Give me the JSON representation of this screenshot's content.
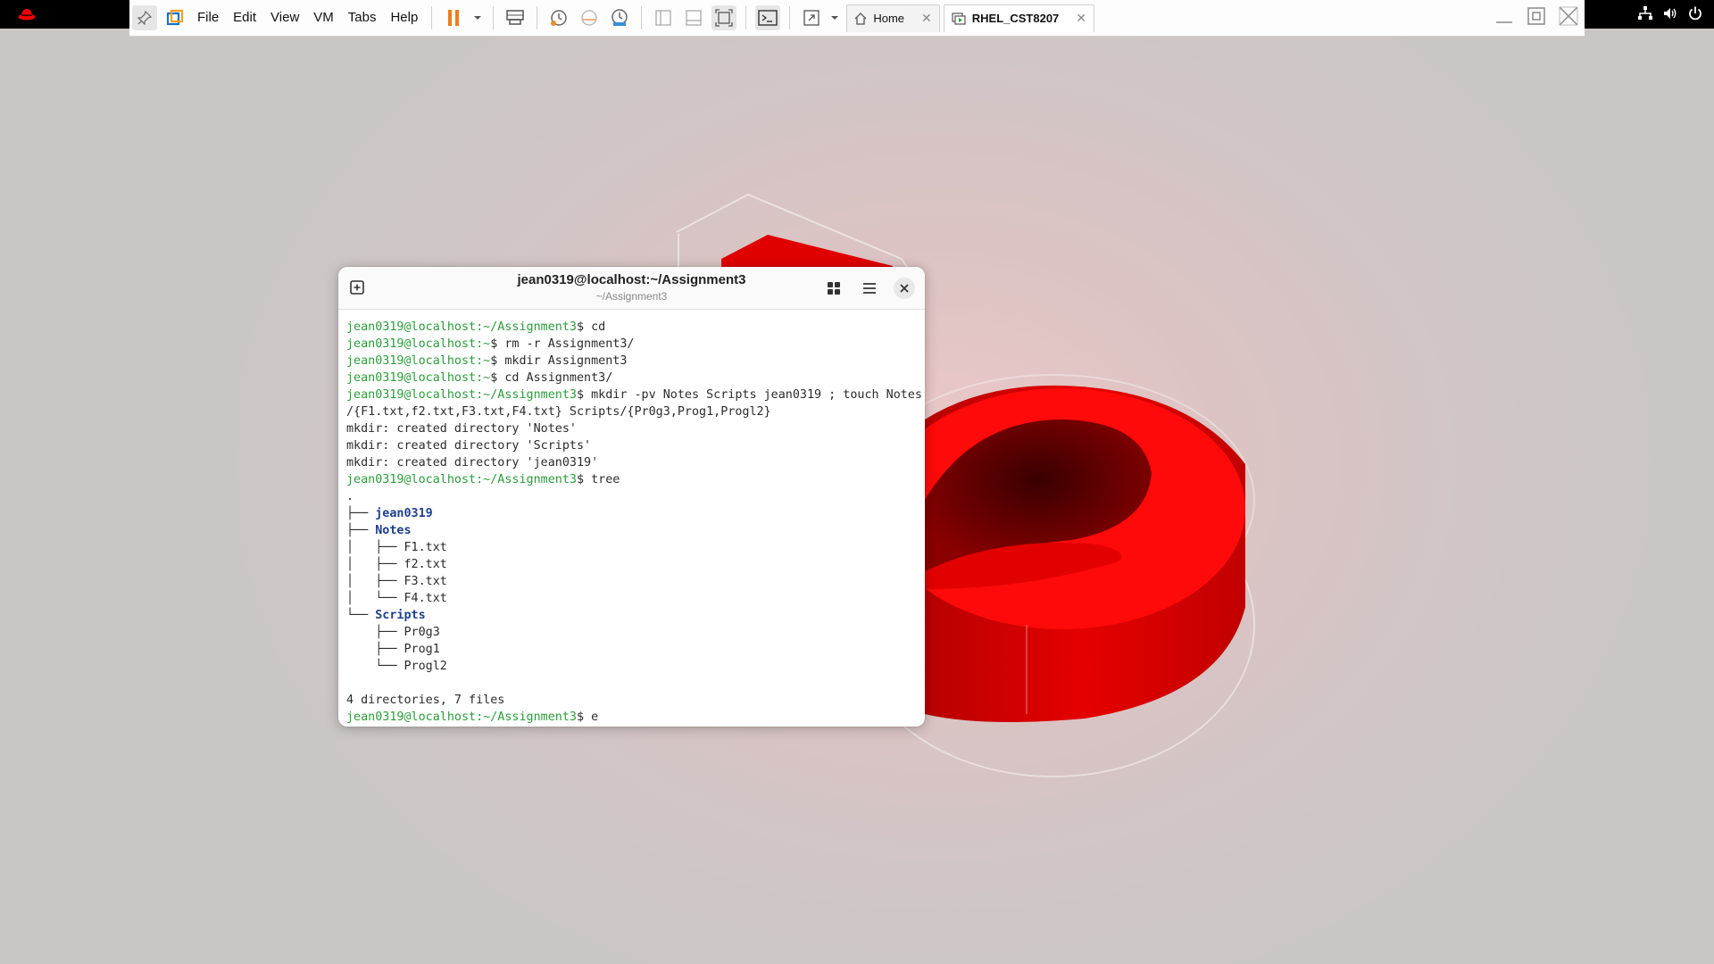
{
  "menu": {
    "file": "File",
    "edit": "Edit",
    "view": "View",
    "vm": "VM",
    "tabs": "Tabs",
    "help": "Help"
  },
  "tabs": [
    {
      "label": "Home",
      "icon": "home-icon"
    },
    {
      "label": "RHEL_CST8207",
      "icon": "vm-icon"
    }
  ],
  "terminal": {
    "title": "jean0319@localhost:~/Assignment3",
    "subtitle": "~/Assignment3",
    "lines": [
      {
        "prompt_user": "jean0319@localhost",
        "prompt_path": ":~/Assignment3",
        "cmd": "$ cd"
      },
      {
        "prompt_user": "jean0319@localhost",
        "prompt_path": ":~",
        "cmd": "$ rm -r Assignment3/"
      },
      {
        "prompt_user": "jean0319@localhost",
        "prompt_path": ":~",
        "cmd": "$ mkdir Assignment3"
      },
      {
        "prompt_user": "jean0319@localhost",
        "prompt_path": ":~",
        "cmd": "$ cd Assignment3/"
      },
      {
        "prompt_user": "jean0319@localhost",
        "prompt_path": ":~/Assignment3",
        "cmd": "$ mkdir -pv Notes Scripts jean0319 ; touch Notes"
      },
      {
        "text": "/{F1.txt,f2.txt,F3.txt,F4.txt} Scripts/{Pr0g3,Prog1,Progl2}"
      },
      {
        "text": "mkdir: created directory 'Notes'"
      },
      {
        "text": "mkdir: created directory 'Scripts'"
      },
      {
        "text": "mkdir: created directory 'jean0319'"
      },
      {
        "prompt_user": "jean0319@localhost",
        "prompt_path": ":~/Assignment3",
        "cmd": "$ tree"
      },
      {
        "text": "."
      },
      {
        "tree": "├── ",
        "dir": "jean0319"
      },
      {
        "tree": "├── ",
        "dir": "Notes"
      },
      {
        "tree": "│   ├── ",
        "text": "F1.txt"
      },
      {
        "tree": "│   ├── ",
        "text": "f2.txt"
      },
      {
        "tree": "│   ├── ",
        "text": "F3.txt"
      },
      {
        "tree": "│   └── ",
        "text": "F4.txt"
      },
      {
        "tree": "└── ",
        "dir": "Scripts"
      },
      {
        "tree": "    ├── ",
        "text": "Pr0g3"
      },
      {
        "tree": "    ├── ",
        "text": "Prog1"
      },
      {
        "tree": "    └── ",
        "text": "Progl2"
      },
      {
        "text": ""
      },
      {
        "text": "4 directories, 7 files"
      },
      {
        "prompt_user": "jean0319@localhost",
        "prompt_path": ":~/Assignment3",
        "cmd": "$ e"
      }
    ]
  },
  "colors": {
    "accent_red": "#ee0000",
    "prompt_green": "#2a9d3a",
    "dir_blue": "#1e3f8f"
  }
}
